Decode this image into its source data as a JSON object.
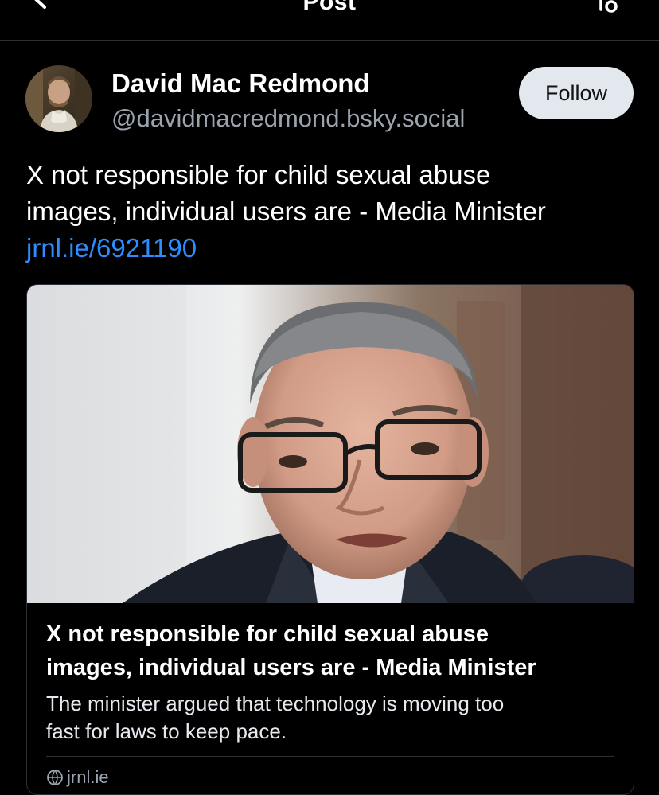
{
  "header": {
    "title": "Post",
    "back_icon": "arrow-left-icon",
    "menu_icon": "thread-settings-icon"
  },
  "author": {
    "display_name": "David Mac Redmond",
    "handle": "@davidmacredmond.bsky.social",
    "follow_label": "Follow"
  },
  "post": {
    "text_line1": "X not responsible for child sexual abuse",
    "text_line2": "images, individual users are - Media Minister",
    "link_text": "jrnl.ie/6921190"
  },
  "link_card": {
    "title_line1": "X not responsible for child sexual abuse",
    "title_line2": "images, individual users are - Media Minister",
    "description_line1": "The minister argued that technology is moving too",
    "description_line2": "fast for laws to keep pace.",
    "domain": "jrnl.ie",
    "domain_icon": "globe-icon"
  },
  "colors": {
    "background": "#000000",
    "link": "#2f8cff",
    "secondary_text": "#9aa3ae",
    "follow_button_bg": "#e3e8ee",
    "border": "#2b2f36"
  }
}
